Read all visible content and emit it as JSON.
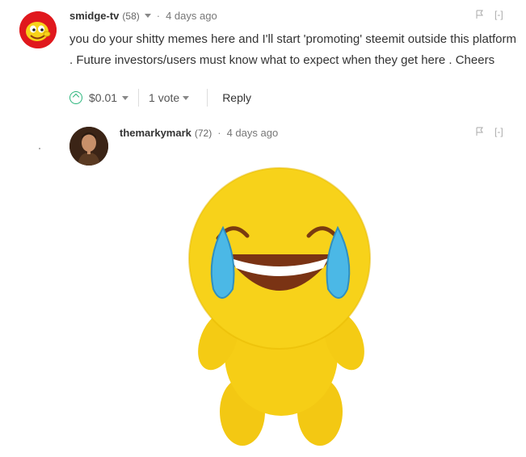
{
  "comment1": {
    "author": "smidge-tv",
    "reputation": "(58)",
    "time": "4 days ago",
    "body": "you do your shitty memes here and I'll start 'promoting' steemit outside this platform . Future investors/users must know what to expect when they get here . Cheers",
    "payout": "$0.01",
    "votes": "1 vote",
    "reply_label": "Reply",
    "collapse_label": "[-]"
  },
  "comment2": {
    "author": "themarkymark",
    "reputation": "(72)",
    "time": "4 days ago",
    "collapse_label": "[-]",
    "image_alt": "crying laughing emoji plush"
  },
  "colors": {
    "accent_green": "#2cb67d",
    "avatar_red": "#e0181d",
    "emoji_yellow": "#f7d21a",
    "tear_blue": "#4bb8e6"
  },
  "icons": {
    "upvote": "upvote-icon",
    "flag": "flag-icon",
    "caret": "caret-down-icon"
  }
}
